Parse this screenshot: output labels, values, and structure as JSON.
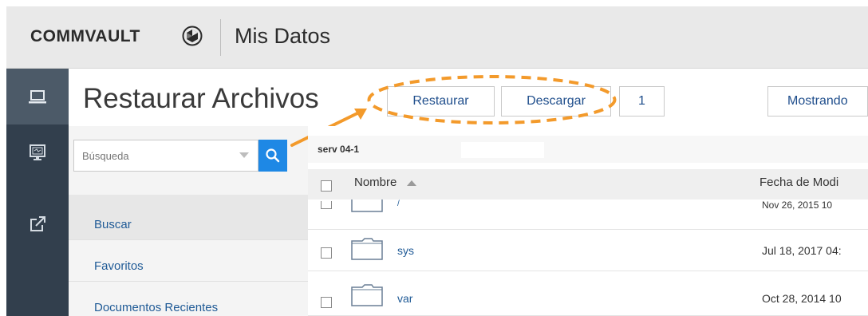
{
  "header": {
    "brand": "COMMVAULT",
    "app_title": "Mis Datos"
  },
  "rail": {
    "items": [
      {
        "icon": "laptop-icon"
      },
      {
        "icon": "monitor-icon"
      },
      {
        "icon": "share-icon"
      }
    ]
  },
  "toolbar": {
    "page_title": "Restaurar Archivos",
    "restore_label": "Restaurar",
    "download_label": "Descargar",
    "selected_count": "1",
    "showing_label": "Mostrando"
  },
  "search": {
    "placeholder": "Búsqueda"
  },
  "nav": {
    "items": [
      {
        "label": "Buscar"
      },
      {
        "label": "Favoritos"
      },
      {
        "label": "Documentos Recientes"
      }
    ]
  },
  "breadcrumb": "serv 04-1",
  "table": {
    "columns": [
      "Nombre",
      "Fecha de Modi"
    ],
    "rows": [
      {
        "name": "/",
        "date": "Nov 26, 2015 10"
      },
      {
        "name": "sys",
        "date": "Jul 18, 2017 04:"
      },
      {
        "name": "var",
        "date": "Oct 28, 2014 10"
      }
    ]
  },
  "colors": {
    "accent": "#1e88e5",
    "annotation": "#f39a2b",
    "rail": "#323f4d",
    "link": "#1f5a96"
  }
}
